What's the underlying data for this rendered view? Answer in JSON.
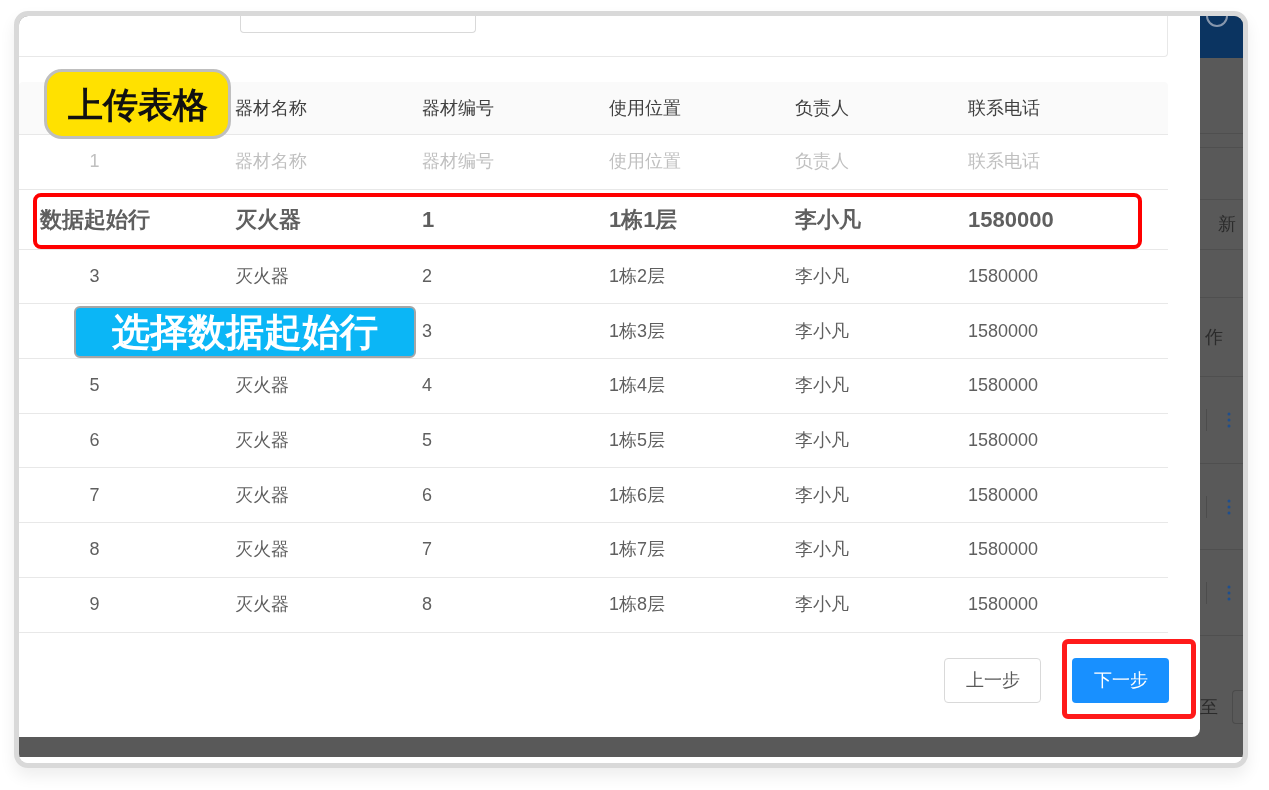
{
  "callouts": {
    "title_label": "上传表格",
    "step_label": "选择数据起始行"
  },
  "table": {
    "columns": [
      "",
      "器材名称",
      "器材编号",
      "使用位置",
      "负责人",
      "联系电话"
    ],
    "rows": [
      {
        "cells": [
          "1",
          "器材名称",
          "器材编号",
          "使用位置",
          "负责人",
          "联系电话"
        ],
        "disabled": true,
        "selected": false
      },
      {
        "cells": [
          "数据起始行",
          "灭火器",
          "1",
          "1栋1层",
          "李小凡",
          "1580000"
        ],
        "disabled": false,
        "selected": true
      },
      {
        "cells": [
          "3",
          "灭火器",
          "2",
          "1栋2层",
          "李小凡",
          "1580000"
        ],
        "disabled": false,
        "selected": false
      },
      {
        "cells": [
          null,
          null,
          "3",
          "1栋3层",
          "李小凡",
          "1580000"
        ],
        "disabled": false,
        "selected": false
      },
      {
        "cells": [
          "5",
          "灭火器",
          "4",
          "1栋4层",
          "李小凡",
          "1580000"
        ],
        "disabled": false,
        "selected": false
      },
      {
        "cells": [
          "6",
          "灭火器",
          "5",
          "1栋5层",
          "李小凡",
          "1580000"
        ],
        "disabled": false,
        "selected": false
      },
      {
        "cells": [
          "7",
          "灭火器",
          "6",
          "1栋6层",
          "李小凡",
          "1580000"
        ],
        "disabled": false,
        "selected": false
      },
      {
        "cells": [
          "8",
          "灭火器",
          "7",
          "1栋7层",
          "李小凡",
          "1580000"
        ],
        "disabled": false,
        "selected": false
      },
      {
        "cells": [
          "9",
          "灭火器",
          "8",
          "1栋8层",
          "李小凡",
          "1580000"
        ],
        "disabled": false,
        "selected": false
      }
    ]
  },
  "footer": {
    "buttons": [
      {
        "label": "上一步",
        "kind": "default",
        "highlighted": false
      },
      {
        "label": "下一步",
        "kind": "primary",
        "highlighted": true
      }
    ]
  },
  "background_page": {
    "toolbar_label": "新",
    "column_header": "作",
    "pagination_label": "至"
  }
}
